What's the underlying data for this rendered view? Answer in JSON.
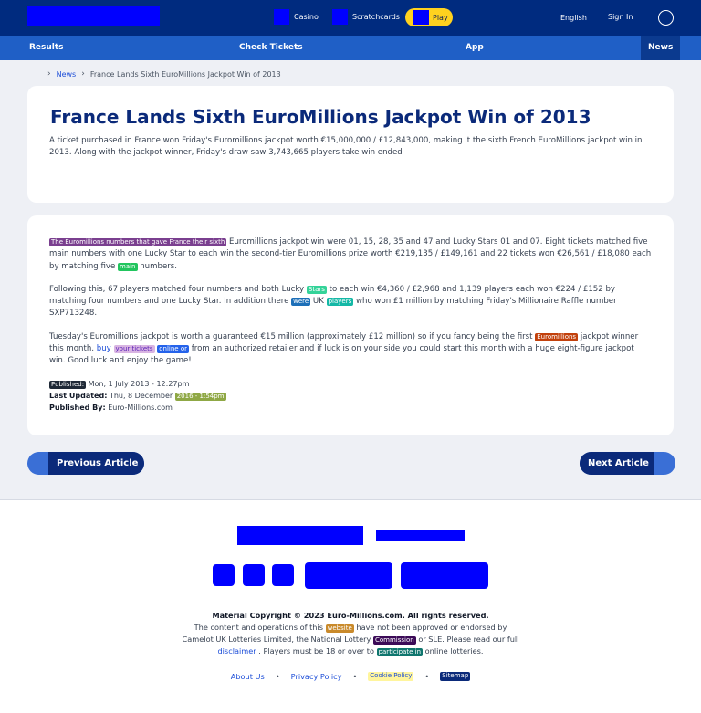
{
  "header": {
    "nav_casino": "Casino",
    "nav_scratchcards": "Scratchcards",
    "nav_play": "Play",
    "language": "English",
    "sign_in": "Sign In"
  },
  "mainnav": {
    "results": "Results",
    "check_tickets": "Check Tickets",
    "app": "App",
    "news": "News"
  },
  "breadcrumb": {
    "news": "News",
    "current": "France Lands Sixth EuroMillions Jackpot Win of 2013"
  },
  "article": {
    "title": "France Lands Sixth EuroMillions Jackpot Win of 2013",
    "lead": "A ticket purchased in France won Friday's Euromillions jackpot worth €15,000,000 / £12,843,000, making it the sixth French EuroMillions jackpot win in 2013. Along with the jackpot winner, Friday's draw saw 3,743,665 players take win ended",
    "p1_chip": "The Euromillions numbers that gave France their sixth",
    "p1_rest": "Euromillions jackpot win were 01, 15, 28, 35 and 47 and Lucky Stars 01 and 07. Eight tickets matched five main numbers with one Lucky Star to each win the second-tier Euromillions prize worth €219,135 / £149,161 and 22 tickets won €26,561 / £18,080 each by matching five",
    "p1_chip2": "main",
    "p1_end": "numbers.",
    "p2_a": "Following this, 67 players matched four numbers and both Lucky",
    "p2_chip1": "Stars",
    "p2_b": "to each win €4,360 / £2,968 and 1,139 players each won €224 / £152 by matching four numbers and one Lucky Star. In addition there",
    "p2_chip2": "were",
    "p2_c": "UK",
    "p2_chip3": "players",
    "p2_d": "who won £1 million by matching Friday's Millionaire Raffle number SXP713248.",
    "p3_a": "Tuesday's Euromillions jackpot is worth a guaranteed €15 million (approximately £12 million) so if you fancy being the first",
    "p3_chip1": "Euromillions",
    "p3_b": "jackpot winner this month,",
    "p3_link": "buy",
    "p3_chip2": "your tickets",
    "p3_chip3": "online or",
    "p3_c": "from an authorized retailer and if luck is on your side you could start this month with a huge eight-figure jackpot win. Good luck and enjoy the game!",
    "meta_published_label": "Published:",
    "meta_published": "Mon, 1 July 2013 - 12:27pm",
    "meta_updated_label": "Last Updated:",
    "meta_updated": "Thu, 8 December",
    "meta_updated_chip": "2016 - 1:54pm",
    "meta_by_label": "Published By:",
    "meta_by": "Euro-Millions.com"
  },
  "pagination": {
    "prev": "Previous Article",
    "next": "Next Article"
  },
  "footer": {
    "copyright": "Material Copyright © 2023 Euro-Millions.com. All rights reserved.",
    "line2_a": "The content and operations of this",
    "line2_chip": "website",
    "line2_b": "have not been approved or endorsed by",
    "line3_a": "Camelot UK Lotteries Limited, the National Lottery",
    "line3_chip": "Commission",
    "line3_b": "or SLE. Please read our full",
    "line4_link": "disclaimer",
    "line4_a": ". Players must be 18 or over to",
    "line4_chip": "participate in",
    "line4_b": "online lotteries.",
    "link_about": "About Us",
    "link_privacy": "Privacy Policy",
    "link_cookie": "Cookie Policy",
    "link_sitemap": "Sitemap"
  }
}
